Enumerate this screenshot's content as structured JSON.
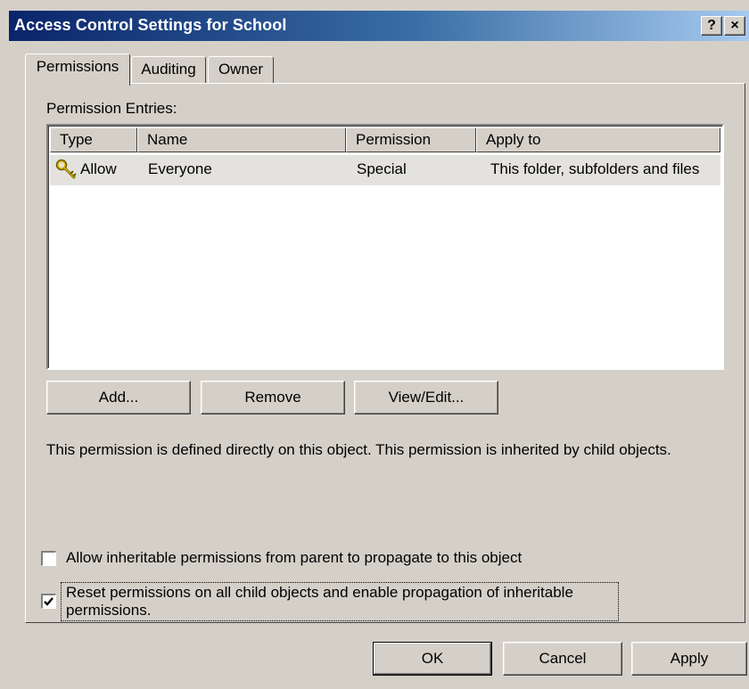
{
  "window": {
    "title": "Access Control Settings for School",
    "help_button": "?",
    "close_button": "×"
  },
  "tabs": [
    {
      "label": "Permissions",
      "active": true
    },
    {
      "label": "Auditing",
      "active": false
    },
    {
      "label": "Owner",
      "active": false
    }
  ],
  "permissions": {
    "entries_label": "Permission Entries:",
    "columns": [
      "Type",
      "Name",
      "Permission",
      "Apply to"
    ],
    "rows": [
      {
        "type": "Allow",
        "name": "Everyone",
        "permission": "Special",
        "apply_to": "This folder, subfolders and files",
        "icon": "keys-icon"
      }
    ],
    "buttons": {
      "add": "Add...",
      "remove": "Remove",
      "view_edit": "View/Edit..."
    },
    "description": "This permission is defined directly on this object. This permission is inherited by child objects.",
    "checkboxes": {
      "inherit_label": "Allow inheritable permissions from parent to propagate to this object",
      "inherit_checked": false,
      "reset_label_line1": "Reset permissions on all child objects and enable propagation of inheritable",
      "reset_label_line2": "permissions.",
      "reset_checked": true
    }
  },
  "footer": {
    "ok": "OK",
    "cancel": "Cancel",
    "apply": "Apply"
  }
}
